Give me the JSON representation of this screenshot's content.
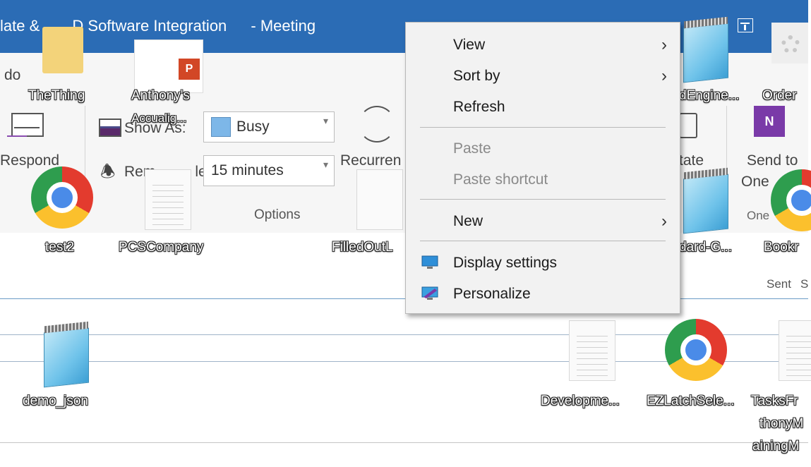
{
  "outlook": {
    "title_left": "late &",
    "title_mid": "D Software Integration",
    "title_right": "- Meeting",
    "todo": "do",
    "respond": "Respond",
    "show_as_label": "Show As:",
    "show_as_value": "Busy",
    "reminder_label_a": "Rem",
    "reminder_label_b": "ler:",
    "reminder_value": "15 minutes",
    "recurrence": "Recurren",
    "options_group": "Options",
    "tate": "tate",
    "send_to_1": "Send to",
    "send_to_2": "One",
    "one_group": "One",
    "sent": "Sent",
    "s": "S"
  },
  "desktop_icons": {
    "thething": "TheThing",
    "anthonys_1": "Anthony's",
    "anthonys_2": "Accualig...",
    "engine": "dEngine...",
    "order": "Order",
    "test2": "test2",
    "pcscompany": "PCSCompany",
    "filledout": "FilledOutL",
    "dard": "dard-G...",
    "bookr": "Bookr",
    "demo_json": "demo_json",
    "developme": "Developme...",
    "ezlatch": "EZLatchSele...",
    "tasks_1": "TasksFr",
    "tasks_2": "thonyM",
    "tasks_3": "ainingM"
  },
  "context_menu": {
    "view": "View",
    "sort_by": "Sort by",
    "refresh": "Refresh",
    "paste": "Paste",
    "paste_shortcut": "Paste shortcut",
    "new": "New",
    "display_settings": "Display settings",
    "personalize": "Personalize"
  },
  "icons": [
    "chrome-icon",
    "notepad-icon",
    "document-icon",
    "folder-icon",
    "powerpoint-icon",
    "onenote-icon",
    "gear-icon",
    "envelope-icon",
    "bell-icon",
    "recurrence-icon",
    "display-settings-icon",
    "personalize-icon",
    "chevron-right-icon"
  ],
  "colors": {
    "title_bar": "#2b6cb5",
    "menu_bg": "#f2f2f2",
    "busy_swatch": "#7db7e8"
  }
}
